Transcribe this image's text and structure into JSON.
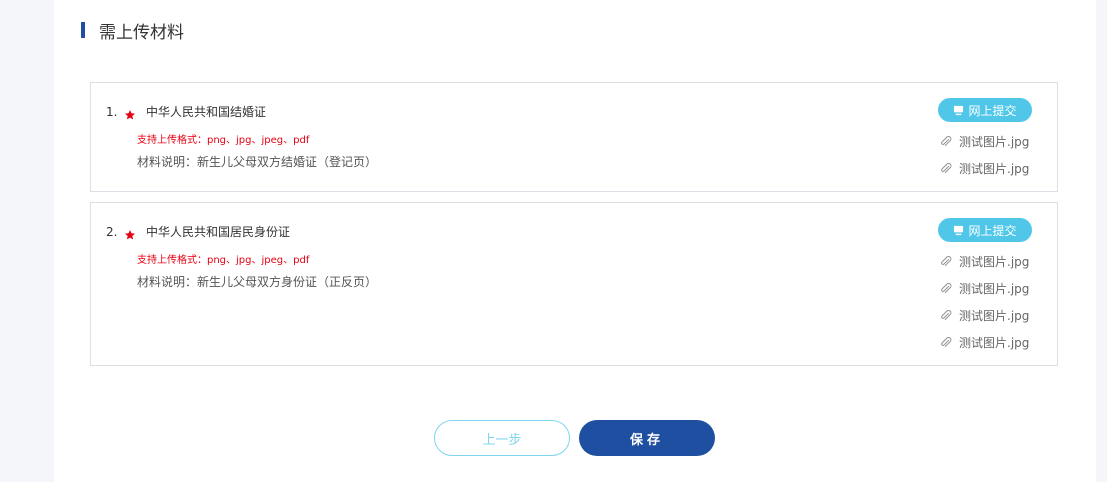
{
  "section": {
    "title": "需上传材料"
  },
  "materials": [
    {
      "number": "1.",
      "name": "中华人民共和国结婚证",
      "formats": "支持上传格式：png、jpg、jpeg、pdf",
      "description": "材料说明：新生儿父母双方结婚证（登记页）",
      "submit_label": "网上提交",
      "files": [
        "测试图片.jpg",
        "测试图片.jpg"
      ]
    },
    {
      "number": "2.",
      "name": "中华人民共和国居民身份证",
      "formats": "支持上传格式：png、jpg、jpeg、pdf",
      "description": "材料说明：新生儿父母双方身份证（正反页）",
      "submit_label": "网上提交",
      "files": [
        "测试图片.jpg",
        "测试图片.jpg",
        "测试图片.jpg",
        "测试图片.jpg"
      ]
    }
  ],
  "buttons": {
    "prev_label": "上一步",
    "save_label": "保存"
  },
  "colors": {
    "accent": "#1f4fa0",
    "submit": "#50c7e9",
    "required": "#e60012"
  },
  "icons": {
    "required": "star-icon",
    "submit": "monitor-icon",
    "file": "paperclip-icon"
  }
}
